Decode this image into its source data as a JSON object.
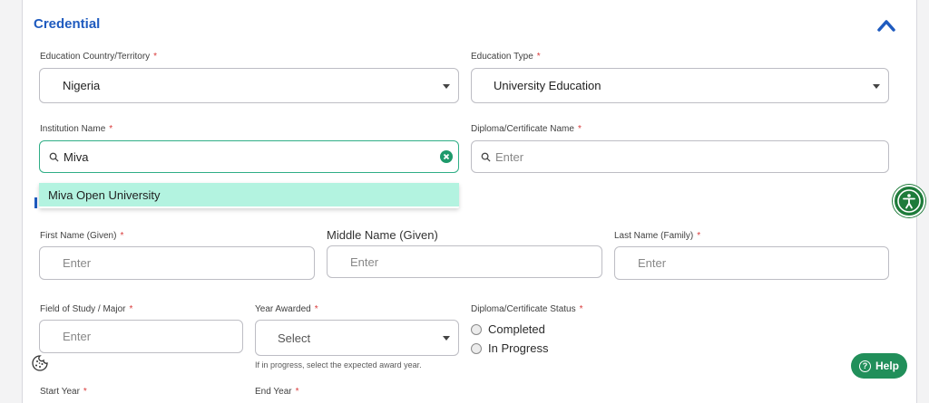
{
  "section": {
    "title": "Credential"
  },
  "education_country": {
    "label": "Education Country/Territory",
    "required": "*",
    "value": "Nigeria"
  },
  "education_type": {
    "label": "Education Type",
    "required": "*",
    "value": "University Education"
  },
  "institution": {
    "label": "Institution Name",
    "required": "*",
    "value": "Miva",
    "suggestion": "Miva Open University"
  },
  "diploma_name": {
    "label": "Diploma/Certificate Name",
    "required": "*",
    "placeholder": "Enter"
  },
  "first_name": {
    "label": "First Name (Given)",
    "required": "*",
    "placeholder": "Enter"
  },
  "middle_name": {
    "label": "Middle Name (Given)",
    "placeholder": "Enter"
  },
  "last_name": {
    "label": "Last Name (Family)",
    "required": "*",
    "placeholder": "Enter"
  },
  "field_of_study": {
    "label": "Field of Study / Major",
    "required": "*",
    "placeholder": "Enter"
  },
  "year_awarded": {
    "label": "Year Awarded",
    "required": "*",
    "value": "Select",
    "hint": "If in progress, select the expected award year."
  },
  "diploma_status": {
    "label": "Diploma/Certificate Status",
    "required": "*",
    "options": [
      "Completed",
      "In Progress"
    ]
  },
  "start_year": {
    "label": "Start Year",
    "required": "*"
  },
  "end_year": {
    "label": "End Year",
    "required": "*"
  },
  "help": {
    "label": "Help",
    "glyph": "?"
  },
  "colors": {
    "accent_blue": "#1f5bbf",
    "focus_green": "#2fae86",
    "highlight": "#b3f3e0",
    "help_green": "#218f5a",
    "required_red": "#d93a3a"
  }
}
